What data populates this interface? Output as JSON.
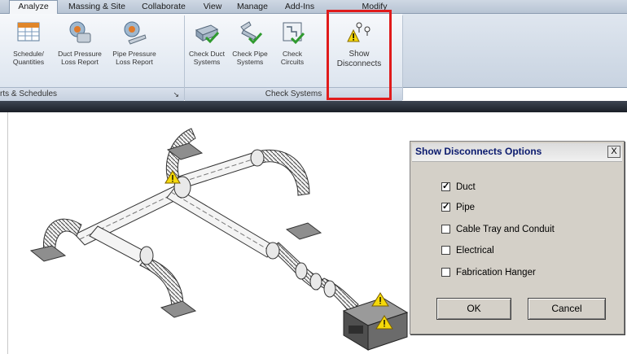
{
  "ribbon": {
    "tabs": [
      {
        "label": "Analyze",
        "active": true
      },
      {
        "label": "Massing & Site"
      },
      {
        "label": "Collaborate"
      },
      {
        "label": "View"
      },
      {
        "label": "Manage"
      },
      {
        "label": "Add-Ins"
      },
      {
        "label": "Modify"
      }
    ],
    "buttons": [
      {
        "label": "Schedule/\nQuantities",
        "icon": "schedule-icon"
      },
      {
        "label": "Duct Pressure\nLoss Report",
        "icon": "duct-pressure-report-icon"
      },
      {
        "label": "Pipe Pressure\nLoss Report",
        "icon": "pipe-pressure-report-icon"
      },
      {
        "label": "Check Duct\nSystems",
        "icon": "check-duct-icon"
      },
      {
        "label": "Check Pipe\nSystems",
        "icon": "check-pipe-icon"
      },
      {
        "label": "Check\nCircuits",
        "icon": "check-circuits-icon"
      },
      {
        "label": "Show\nDisconnects",
        "icon": "show-disconnects-icon",
        "highlighted": true
      }
    ],
    "panels": [
      {
        "label": "rts & Schedules"
      },
      {
        "label": "Check Systems"
      }
    ]
  },
  "dialog": {
    "title": "Show Disconnects Options",
    "close_label": "X",
    "options": [
      {
        "label": "Duct",
        "checked": true
      },
      {
        "label": "Pipe",
        "checked": true
      },
      {
        "label": "Cable Tray and Conduit",
        "checked": false
      },
      {
        "label": "Electrical",
        "checked": false
      },
      {
        "label": "Fabrication Hanger",
        "checked": false
      }
    ],
    "ok_label": "OK",
    "cancel_label": "Cancel"
  },
  "colors": {
    "highlight": "#e01b1b",
    "warning": "#f5d90a"
  }
}
